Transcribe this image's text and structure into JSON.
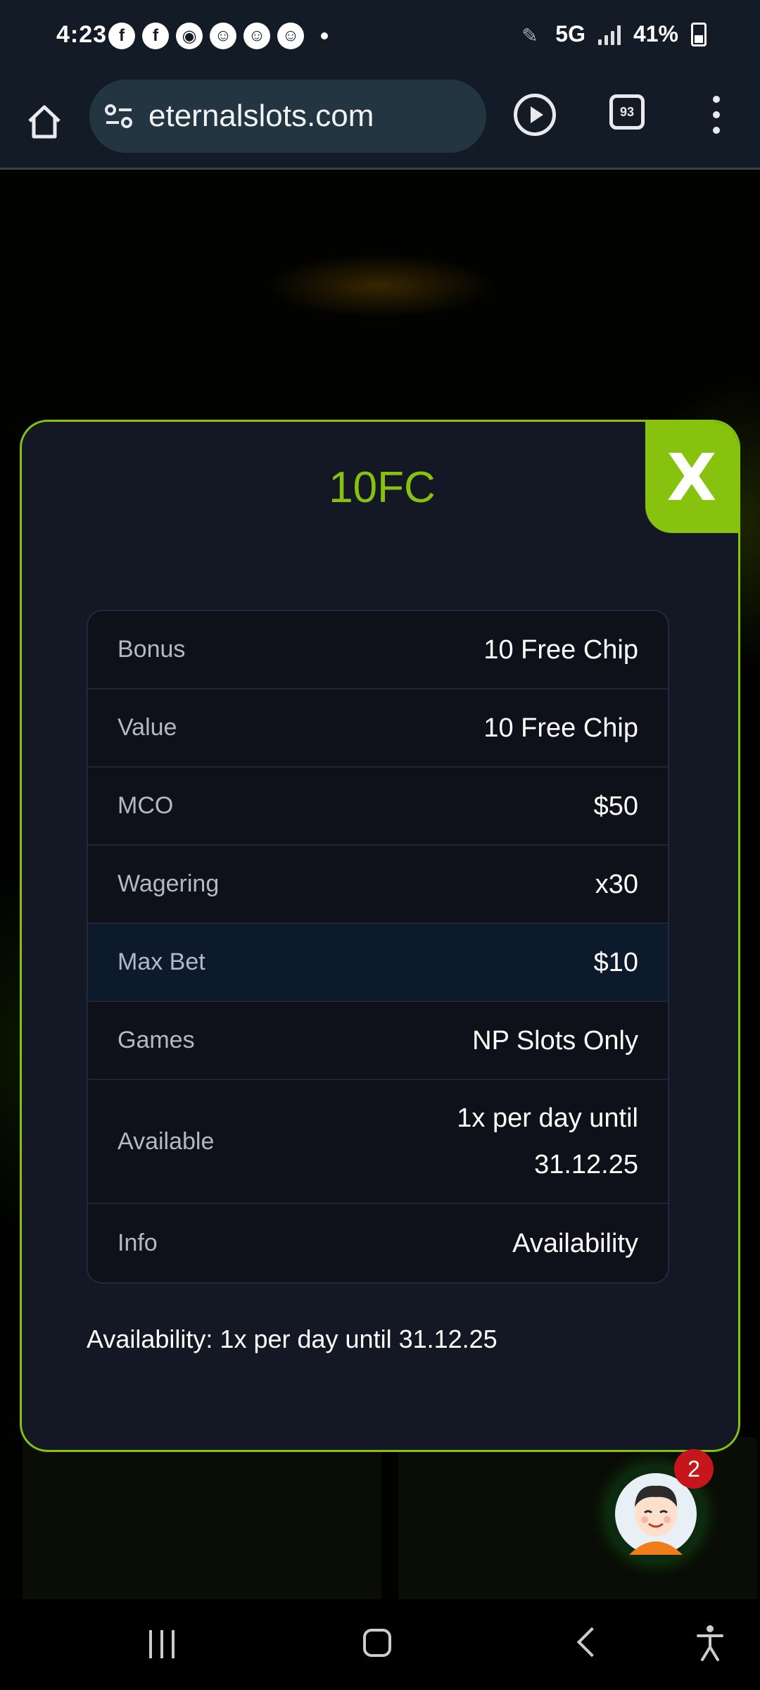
{
  "status_bar": {
    "time": "4:23",
    "network": "5G",
    "battery": "41%",
    "notification_icons": [
      "facebook-icon",
      "facebook-icon",
      "discord-icon",
      "snapchat-icon",
      "snapchat-icon",
      "snapchat-icon"
    ]
  },
  "browser": {
    "url": "eternalslots.com",
    "tab_count": "93"
  },
  "modal": {
    "title": "10FC",
    "close_label": "X",
    "rows": [
      {
        "label": "Bonus",
        "value": "10 Free Chip"
      },
      {
        "label": "Value",
        "value": "10 Free Chip"
      },
      {
        "label": "MCO",
        "value": "$50"
      },
      {
        "label": "Wagering",
        "value": "x30"
      },
      {
        "label": "Max Bet",
        "value": "$10"
      },
      {
        "label": "Games",
        "value": "NP Slots Only"
      },
      {
        "label": "Available",
        "value": "1x per day until 31.12.25"
      },
      {
        "label": "Info",
        "value": "Availability"
      }
    ],
    "note": "Availability: 1x per day until 31.12.25"
  },
  "chat": {
    "badge_count": "2"
  },
  "colors": {
    "accent": "#86c20e",
    "modal_bg": "#141824",
    "highlight_row": "#0c1a2c",
    "badge": "#c5161c"
  }
}
